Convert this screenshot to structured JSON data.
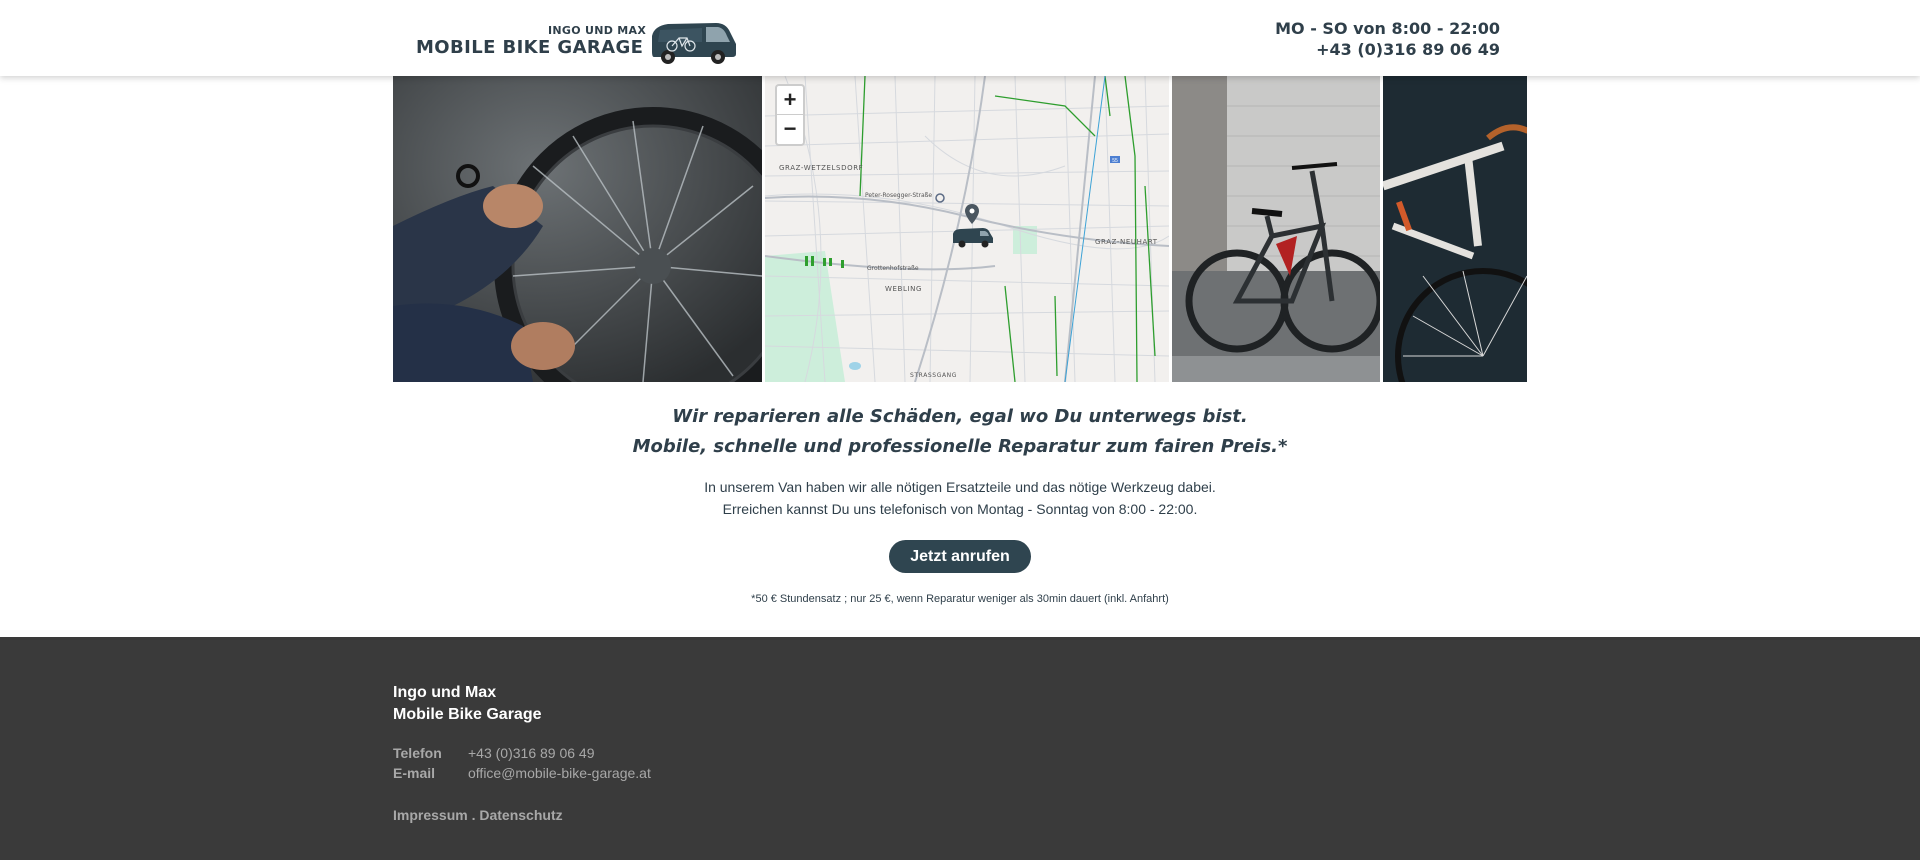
{
  "header": {
    "logo_small": "INGO UND MAX",
    "logo_big": "MOBILE BIKE GARAGE",
    "hours": "MO - SO von 8:00 - 22:00",
    "phone": "+43 (0)316 89 06 49"
  },
  "map": {
    "zoom_in": "+",
    "zoom_out": "−",
    "labels": {
      "wetzelsdorf": "GRAZ-WETZELSDORF",
      "neuhart": "GRAZ-NEUHART",
      "webling": "WEBLING",
      "strassgang": "STRASSGANG",
      "grottenhof": "Grottenhofstraße",
      "rosegger": "Peter-Rosegger-Straße",
      "route": "55"
    }
  },
  "main": {
    "headline1": "Wir reparieren alle Schäden, egal wo Du unterwegs bist.",
    "headline2": "Mobile, schnelle und professionelle Reparatur zum fairen Preis.*",
    "text1": "In unserem Van haben wir alle nötigen Ersatzteile und das nötige Werkzeug dabei.",
    "text2": "Erreichen kannst Du uns telefonisch von Montag - Sonntag von 8:00 - 22:00.",
    "cta": "Jetzt anrufen",
    "footnote": "*50 € Stundensatz ; nur 25 €, wenn Reparatur weniger als 30min dauert (inkl. Anfahrt)"
  },
  "footer": {
    "name1": "Ingo und Max",
    "name2": "Mobile Bike Garage",
    "phone_label": "Telefon",
    "phone": "+43 (0)316 89 06 49",
    "email_label": "E-mail",
    "email": "office@mobile-bike-garage.at",
    "impressum": "Impressum",
    "separator": ".",
    "datenschutz": "Datenschutz"
  },
  "colors": {
    "brand": "#2f4550",
    "text": "#2f3f4a",
    "footer_bg": "#3a3a3a",
    "footer_text": "#a8a8a8"
  },
  "icons": [
    "van-logo-icon",
    "map-pin-icon",
    "van-marker-icon"
  ]
}
